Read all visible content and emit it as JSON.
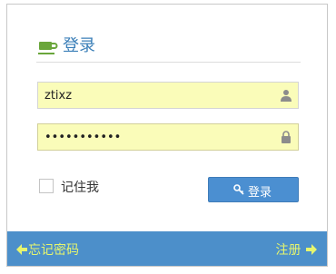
{
  "login": {
    "title": "登录",
    "title_icon": "coffee-cup-icon",
    "username": {
      "value": "ztixz",
      "icon": "user-icon"
    },
    "password": {
      "value": "•••••••••••",
      "icon": "lock-icon"
    },
    "remember_label": "记住我",
    "remember_checked": false,
    "submit_label": "登录",
    "submit_icon": "key-icon"
  },
  "footer": {
    "forgot_label": "忘记密码",
    "forgot_icon": "arrow-left-icon",
    "register_label": "注册",
    "register_icon": "arrow-right-icon"
  },
  "colors": {
    "title": "#3b7fb8",
    "field_bg": "#fafcb9",
    "button": "#4b8fd1",
    "footer_bg": "#4c8fca",
    "footer_text": "#e6f56e",
    "cup": "#6aa63b"
  }
}
